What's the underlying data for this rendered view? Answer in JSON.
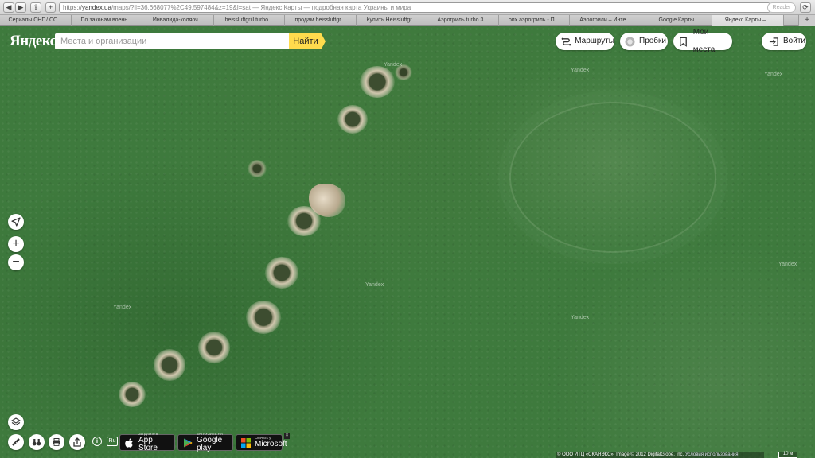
{
  "browser": {
    "nav_back": "◀",
    "nav_forward": "▶",
    "share": "⇪",
    "add": "+",
    "url_scheme": "https",
    "url_domain": "yandex.ua",
    "url_path": "/maps/?ll=36.668077%2C49.597484&z=19&l=sat",
    "url_title": " — Яндекс.Карты — подробная карта Украины и мира",
    "reader_label": "Reader",
    "tabs": [
      "Сериалы СНГ / СС...",
      "По законам военн...",
      "Инвалида-коляоч...",
      "heissluftgrill turbo...",
      "продам heissluftgr...",
      "Купить Heissluftgr...",
      "Аэрогриль turbo 3...",
      "опх аэрогриль - П...",
      "Аэрогрили – Инте...",
      "Google Карты",
      "Яндекс.Карты –..."
    ],
    "tab_add": "+"
  },
  "header": {
    "logo": "Яндекс",
    "search_placeholder": "Места и организации",
    "search_button": "Найти",
    "routes": "Маршруты",
    "traffic": "Пробки",
    "my_places": "Мои места",
    "login": "Войти"
  },
  "map": {
    "watermark": "Yandex",
    "copyright": "© ООО ИТЦ «СКАНЭКС», Image © 2012 DigitalGlobe, Inc.",
    "terms": "Условия использования",
    "scale": "10 м"
  },
  "controls": {
    "zoom_in": "+",
    "zoom_out": "−",
    "info": "i",
    "lang": "Ru"
  },
  "stores": {
    "appstore_small": "Загрузите в",
    "appstore_big": "App Store",
    "googleplay_small": "ЗАГРУЗИТЕ НА",
    "googleplay_big": "Google play",
    "microsoft_small": "Скачать у",
    "microsoft_big": "Microsoft",
    "close": "×"
  }
}
